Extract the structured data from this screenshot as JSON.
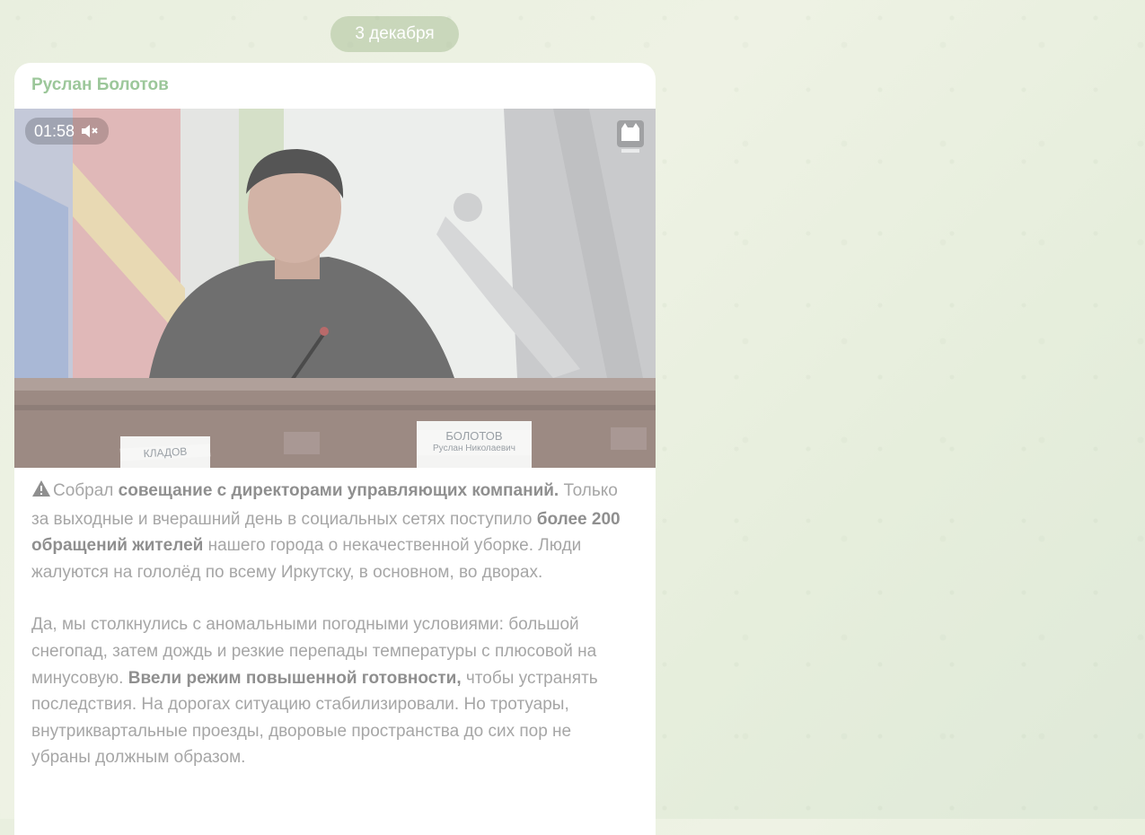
{
  "date_separator": "3 декабря",
  "message": {
    "author": "Руслан Болотов",
    "video": {
      "duration": "01:58",
      "muted": true,
      "mute_icon": "speaker-muted-icon",
      "watermark_icon": "tv-cat-logo-icon",
      "name_plates": {
        "left": "КЛАДОВ",
        "right_line1": "БОЛОТОВ",
        "right_line2": "Руслан Николаевич"
      }
    },
    "paragraph1": {
      "icon": "warning-icon",
      "seg1": "Собрал ",
      "seg2_bold": "совещание с директорами управляющих компаний.",
      "seg3": " Только за выходные и вчерашний день в социальных сетях поступило ",
      "seg4_bold": "более 200 обращений жителей",
      "seg5": " нашего города о некачественной уборке. Люди жалуются на гололёд по всему Иркутску, в основном, во дворах."
    },
    "paragraph2": {
      "seg1": "Да, мы столкнулись с аномальными погодными условиями: большой снегопад, затем дождь и резкие перепады температуры с плюсовой на минусовую. ",
      "seg2_bold": "Ввели режим повышенной готовности,",
      "seg3": " чтобы устранять последствия. На дорогах ситуацию стабилизировали. Но тротуары, внутриквартальные проезды, дворовые пространства до сих пор не убраны должным образом."
    }
  },
  "colors": {
    "author": "#9cc79a",
    "background": "#e9efdf",
    "text": "#a6a6a6"
  }
}
